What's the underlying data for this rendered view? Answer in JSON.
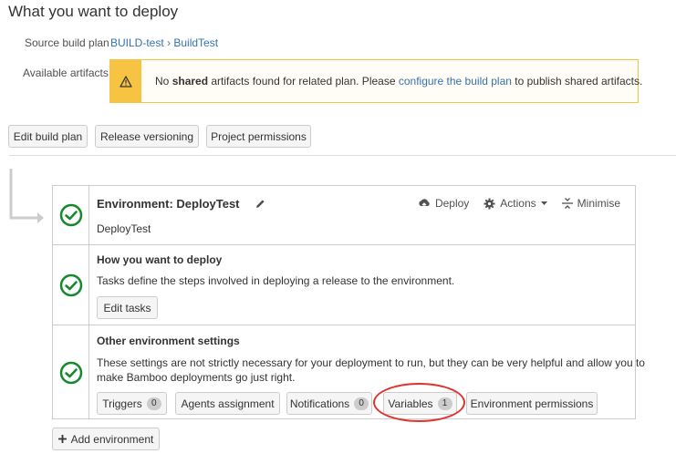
{
  "page": {
    "heading": "What you want to deploy"
  },
  "source": {
    "label": "Source build plan",
    "project": "BUILD-test",
    "separator": "›",
    "plan": "BuildTest"
  },
  "artifacts": {
    "label": "Available artifacts",
    "warning_prefix": "No ",
    "warning_bold": "shared",
    "warning_middle": " artifacts found for related plan. Please ",
    "warning_link": "configure the build plan",
    "warning_suffix": " to publish shared artifacts."
  },
  "toolbar": {
    "edit_build_plan": "Edit build plan",
    "release_versioning": "Release versioning",
    "project_permissions": "Project permissions"
  },
  "environment": {
    "title": "Environment: DeployTest",
    "name": "DeployTest",
    "deploy_label": "Deploy",
    "actions_label": "Actions",
    "minimise_label": "Minimise"
  },
  "how_deploy": {
    "title": "How you want to deploy",
    "description": "Tasks define the steps involved in deploying a release to the environment.",
    "edit_tasks": "Edit tasks"
  },
  "other_settings": {
    "title": "Other environment settings",
    "description_line1": "These settings are not strictly necessary for your deployment to run, but they can be very helpful and allow you to",
    "description_line2": "make Bamboo deployments go just right.",
    "triggers": "Triggers",
    "triggers_count": "0",
    "agents": "Agents assignment",
    "notifications": "Notifications",
    "notifications_count": "0",
    "variables": "Variables",
    "variables_count": "1",
    "env_permissions": "Environment permissions"
  },
  "add_environment": {
    "label": "Add environment"
  },
  "colors": {
    "link": "#3572b0",
    "warning": "#f6c342",
    "success": "#14892c",
    "highlight": "#e0332e"
  }
}
